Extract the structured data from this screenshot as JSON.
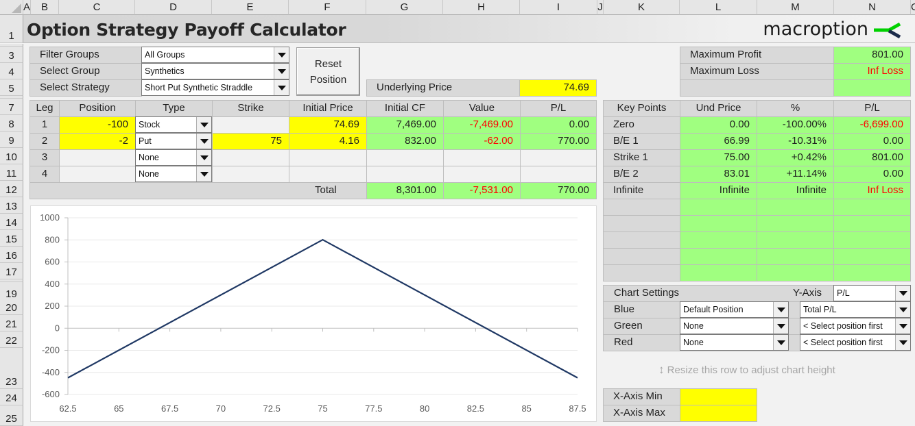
{
  "sheet": {
    "columns": [
      "A",
      "B",
      "C",
      "D",
      "E",
      "F",
      "G",
      "H",
      "I",
      "J",
      "K",
      "L",
      "M",
      "N",
      "O"
    ],
    "rows": [
      "1",
      "3",
      "4",
      "5",
      "7",
      "8",
      "9",
      "10",
      "11",
      "12",
      "13",
      "14",
      "15",
      "16",
      "17",
      "19",
      "20",
      "21",
      "22",
      "23",
      "24",
      "25"
    ]
  },
  "header": {
    "title": "Option Strategy Payoff Calculator",
    "logo_text": "macroption",
    "logo_colors": {
      "green": "#00d100",
      "navy": "#1c2b4a"
    }
  },
  "selectors": {
    "filter_groups": {
      "label": "Filter Groups",
      "value": "All Groups"
    },
    "select_group": {
      "label": "Select Group",
      "value": "Synthetics"
    },
    "select_strategy": {
      "label": "Select Strategy",
      "value": "Short Put Synthetic Straddle"
    },
    "reset_button": "Reset Position"
  },
  "underlying": {
    "label": "Underlying Price",
    "value": "74.69"
  },
  "summary": {
    "max_profit": {
      "label": "Maximum Profit",
      "value": "801.00"
    },
    "max_loss": {
      "label": "Maximum Loss",
      "value": "Inf Loss"
    }
  },
  "legs_table": {
    "headers": [
      "Leg",
      "Position",
      "Type",
      "Strike",
      "Initial Price",
      "Initial CF",
      "Value",
      "P/L"
    ],
    "rows": [
      {
        "leg": "1",
        "position": "-100",
        "type": "Stock",
        "strike": "",
        "initial_price": "74.69",
        "initial_cf": "7,469.00",
        "value": "-7,469.00",
        "pl": "0.00"
      },
      {
        "leg": "2",
        "position": "-2",
        "type": "Put",
        "strike": "75",
        "initial_price": "4.16",
        "initial_cf": "832.00",
        "value": "-62.00",
        "pl": "770.00"
      },
      {
        "leg": "3",
        "position": "",
        "type": "None",
        "strike": "",
        "initial_price": "",
        "initial_cf": "",
        "value": "",
        "pl": ""
      },
      {
        "leg": "4",
        "position": "",
        "type": "None",
        "strike": "",
        "initial_price": "",
        "initial_cf": "",
        "value": "",
        "pl": ""
      }
    ],
    "total": {
      "label": "Total",
      "initial_cf": "8,301.00",
      "value": "-7,531.00",
      "pl": "770.00"
    }
  },
  "key_points": {
    "headers": [
      "Key Points",
      "Und Price",
      "%",
      "P/L"
    ],
    "rows": [
      {
        "name": "Zero",
        "und_price": "0.00",
        "pct": "-100.00%",
        "pl": "-6,699.00"
      },
      {
        "name": "B/E 1",
        "und_price": "66.99",
        "pct": "-10.31%",
        "pl": "0.00"
      },
      {
        "name": "Strike 1",
        "und_price": "75.00",
        "pct": "+0.42%",
        "pl": "801.00"
      },
      {
        "name": "B/E 2",
        "und_price": "83.01",
        "pct": "+11.14%",
        "pl": "0.00"
      },
      {
        "name": "Infinite",
        "und_price": "Infinite",
        "pct": "Infinite",
        "pl": "Inf Loss"
      }
    ]
  },
  "chart_settings": {
    "title": "Chart Settings",
    "y_axis_label": "Y-Axis",
    "y_axis_value": "P/L",
    "rows": [
      {
        "label": "Blue",
        "position": "Default Position",
        "series": "Total P/L"
      },
      {
        "label": "Green",
        "position": "None",
        "series": "< Select position first"
      },
      {
        "label": "Red",
        "position": "None",
        "series": "< Select position first"
      }
    ],
    "resize_hint": "Resize this row to adjust chart height",
    "x_axis_min": {
      "label": "X-Axis Min",
      "value": ""
    },
    "x_axis_max": {
      "label": "X-Axis Max",
      "value": ""
    }
  },
  "chart_data": {
    "type": "line",
    "title": "",
    "xlabel": "",
    "ylabel": "",
    "x": [
      62.5,
      75,
      87.5
    ],
    "series": [
      {
        "name": "Total P/L",
        "color": "#1f3864",
        "values": [
          -449,
          801,
          -449
        ]
      }
    ],
    "xticks": [
      "62.5",
      "65",
      "67.5",
      "70",
      "72.5",
      "75",
      "77.5",
      "80",
      "82.5",
      "85",
      "87.5"
    ],
    "yticks": [
      "1000",
      "800",
      "600",
      "400",
      "200",
      "0",
      "-200",
      "-400",
      "-600"
    ],
    "xlim": [
      62.5,
      87.5
    ],
    "ylim": [
      -600,
      1000
    ],
    "grid": true,
    "legend": "none"
  }
}
